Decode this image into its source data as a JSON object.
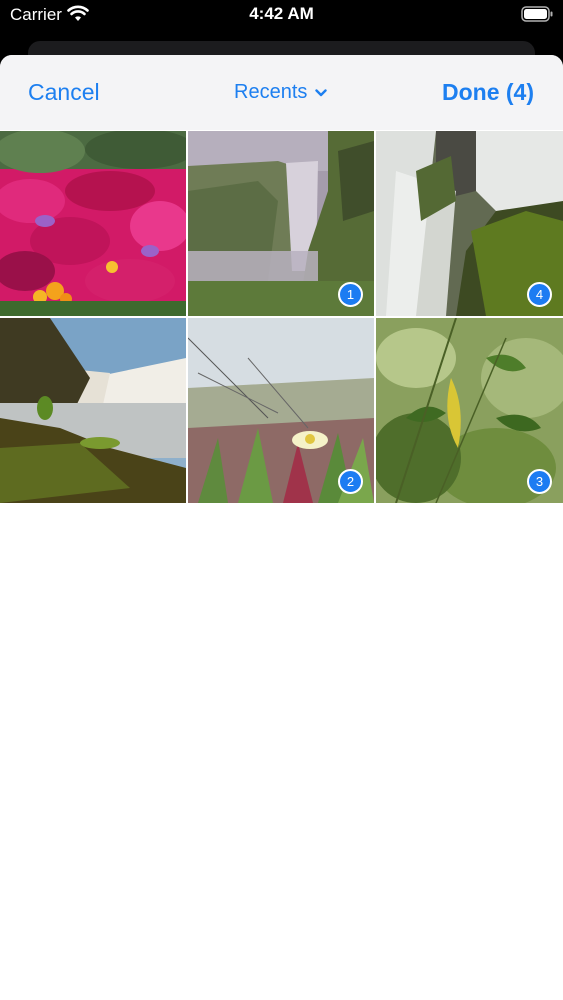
{
  "status_bar": {
    "carrier": "Carrier",
    "time": "4:42 AM"
  },
  "nav": {
    "cancel_label": "Cancel",
    "album_label": "Recents",
    "done_label": "Done (4)"
  },
  "colors": {
    "accent": "#1d7ff0",
    "badge": "#1c7cf2"
  },
  "photos": [
    {
      "subject": "pink-flowers",
      "selection_order": ""
    },
    {
      "subject": "waterfall-cliff",
      "selection_order": "1"
    },
    {
      "subject": "waterfall-closeup",
      "selection_order": "4"
    },
    {
      "subject": "waterfall-rocks",
      "selection_order": ""
    },
    {
      "subject": "white-flower-plants",
      "selection_order": "2"
    },
    {
      "subject": "green-leaves",
      "selection_order": "3"
    }
  ]
}
